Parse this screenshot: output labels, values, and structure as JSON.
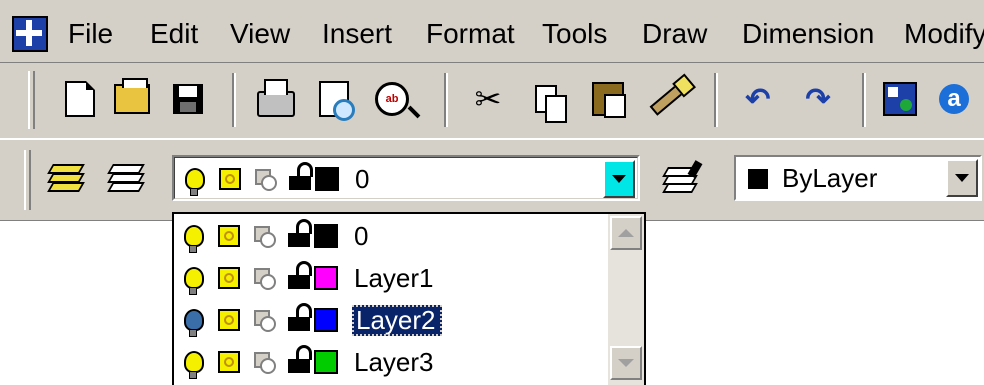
{
  "menubar": {
    "app_icon": "autocad-app-icon",
    "items": [
      "File",
      "Edit",
      "View",
      "Insert",
      "Format",
      "Tools",
      "Draw",
      "Dimension",
      "Modify"
    ]
  },
  "standard_toolbar": {
    "icons": [
      "new-icon",
      "open-icon",
      "save-icon",
      "print-icon",
      "print-preview-icon",
      "spell-check-icon",
      "cut-icon",
      "copy-icon",
      "paste-icon",
      "match-properties-icon",
      "undo-icon",
      "redo-icon",
      "design-center-icon",
      "autodesk-online-icon"
    ]
  },
  "layers_toolbar": {
    "current_layer": "0",
    "current_layer_color": "#000000",
    "linetype_combo": {
      "value": "ByLayer",
      "color": "#000000"
    }
  },
  "layer_dropdown": {
    "items": [
      {
        "name": "0",
        "color": "#000000",
        "bulb_on": true,
        "selected": false
      },
      {
        "name": "Layer1",
        "color": "#ff00ff",
        "bulb_on": true,
        "selected": false
      },
      {
        "name": "Layer2",
        "color": "#0000ff",
        "bulb_on": false,
        "selected": true
      },
      {
        "name": "Layer3",
        "color": "#00cc00",
        "bulb_on": true,
        "selected": false
      }
    ]
  },
  "colors": {
    "chrome": "#d4d0c8",
    "selection": "#0a246a",
    "combo_button": "#00e6e6"
  }
}
